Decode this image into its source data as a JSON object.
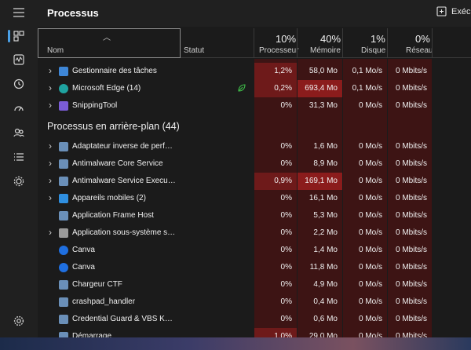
{
  "header": {
    "title": "Processus",
    "run_label": "Exécu"
  },
  "columns": {
    "name": "Nom",
    "status": "Statut",
    "cpu": {
      "pct": "10%",
      "label": "Processeur"
    },
    "mem": {
      "pct": "40%",
      "label": "Mémoire"
    },
    "disk": {
      "pct": "1%",
      "label": "Disque"
    },
    "net": {
      "pct": "0%",
      "label": "Réseau"
    }
  },
  "section_background": "Processus en arrière-plan (44)",
  "apps": [
    {
      "name": "Gestionnaire des tâches",
      "cpu": "1,2%",
      "mem": "58,0 Mo",
      "disk": "0,1 Mo/s",
      "net": "0 Mbits/s",
      "icon": "task-manager-icon",
      "color": "#3e86d6",
      "expand": true
    },
    {
      "name": "Microsoft Edge (14)",
      "cpu": "0,2%",
      "mem": "693,4 Mo",
      "disk": "0,1 Mo/s",
      "net": "0 Mbits/s",
      "icon": "edge-icon",
      "color": "#1fa3a0",
      "expand": true,
      "eco": true
    },
    {
      "name": "SnippingTool",
      "cpu": "0%",
      "mem": "31,3 Mo",
      "disk": "0 Mo/s",
      "net": "0 Mbits/s",
      "icon": "snipping-tool-icon",
      "color": "#7a5cd6",
      "expand": true
    }
  ],
  "background": [
    {
      "name": "Adaptateur inverse de perfor...",
      "cpu": "0%",
      "mem": "1,6 Mo",
      "disk": "0 Mo/s",
      "net": "0 Mbits/s",
      "icon": "service-window-icon",
      "color": "#6a8fb8",
      "expand": true
    },
    {
      "name": "Antimalware Core Service",
      "cpu": "0%",
      "mem": "8,9 Mo",
      "disk": "0 Mo/s",
      "net": "0 Mbits/s",
      "icon": "service-window-icon",
      "color": "#6a8fb8",
      "expand": true
    },
    {
      "name": "Antimalware Service Executable",
      "cpu": "0,9%",
      "mem": "169,1 Mo",
      "disk": "0 Mo/s",
      "net": "0 Mbits/s",
      "icon": "service-window-icon",
      "color": "#6a8fb8",
      "expand": true
    },
    {
      "name": "Appareils mobiles (2)",
      "cpu": "0%",
      "mem": "16,1 Mo",
      "disk": "0 Mo/s",
      "net": "0 Mbits/s",
      "icon": "mobile-devices-icon",
      "color": "#2f8fe0",
      "expand": true
    },
    {
      "name": "Application Frame Host",
      "cpu": "0%",
      "mem": "5,3 Mo",
      "disk": "0 Mo/s",
      "net": "0 Mbits/s",
      "icon": "service-window-icon",
      "color": "#6a8fb8",
      "expand": false
    },
    {
      "name": "Application sous-système spo...",
      "cpu": "0%",
      "mem": "2,2 Mo",
      "disk": "0 Mo/s",
      "net": "0 Mbits/s",
      "icon": "printer-icon",
      "color": "#9a9a9a",
      "expand": true
    },
    {
      "name": "Canva",
      "cpu": "0%",
      "mem": "1,4 Mo",
      "disk": "0 Mo/s",
      "net": "0 Mbits/s",
      "icon": "canva-icon",
      "color": "#1f6fe0",
      "expand": false
    },
    {
      "name": "Canva",
      "cpu": "0%",
      "mem": "11,8 Mo",
      "disk": "0 Mo/s",
      "net": "0 Mbits/s",
      "icon": "canva-icon",
      "color": "#1f6fe0",
      "expand": false
    },
    {
      "name": "Chargeur CTF",
      "cpu": "0%",
      "mem": "4,9 Mo",
      "disk": "0 Mo/s",
      "net": "0 Mbits/s",
      "icon": "service-window-icon",
      "color": "#6a8fb8",
      "expand": false
    },
    {
      "name": "crashpad_handler",
      "cpu": "0%",
      "mem": "0,4 Mo",
      "disk": "0 Mo/s",
      "net": "0 Mbits/s",
      "icon": "service-window-icon",
      "color": "#6a8fb8",
      "expand": false
    },
    {
      "name": "Credential Guard & VBS Key Is...",
      "cpu": "0%",
      "mem": "0,6 Mo",
      "disk": "0 Mo/s",
      "net": "0 Mbits/s",
      "icon": "service-window-icon",
      "color": "#6a8fb8",
      "expand": false
    },
    {
      "name": "Démarrage",
      "cpu": "1,0%",
      "mem": "29,0 Mo",
      "disk": "0 Mo/s",
      "net": "0 Mbits/s",
      "icon": "service-window-icon",
      "color": "#6a8fb8",
      "expand": false
    }
  ]
}
